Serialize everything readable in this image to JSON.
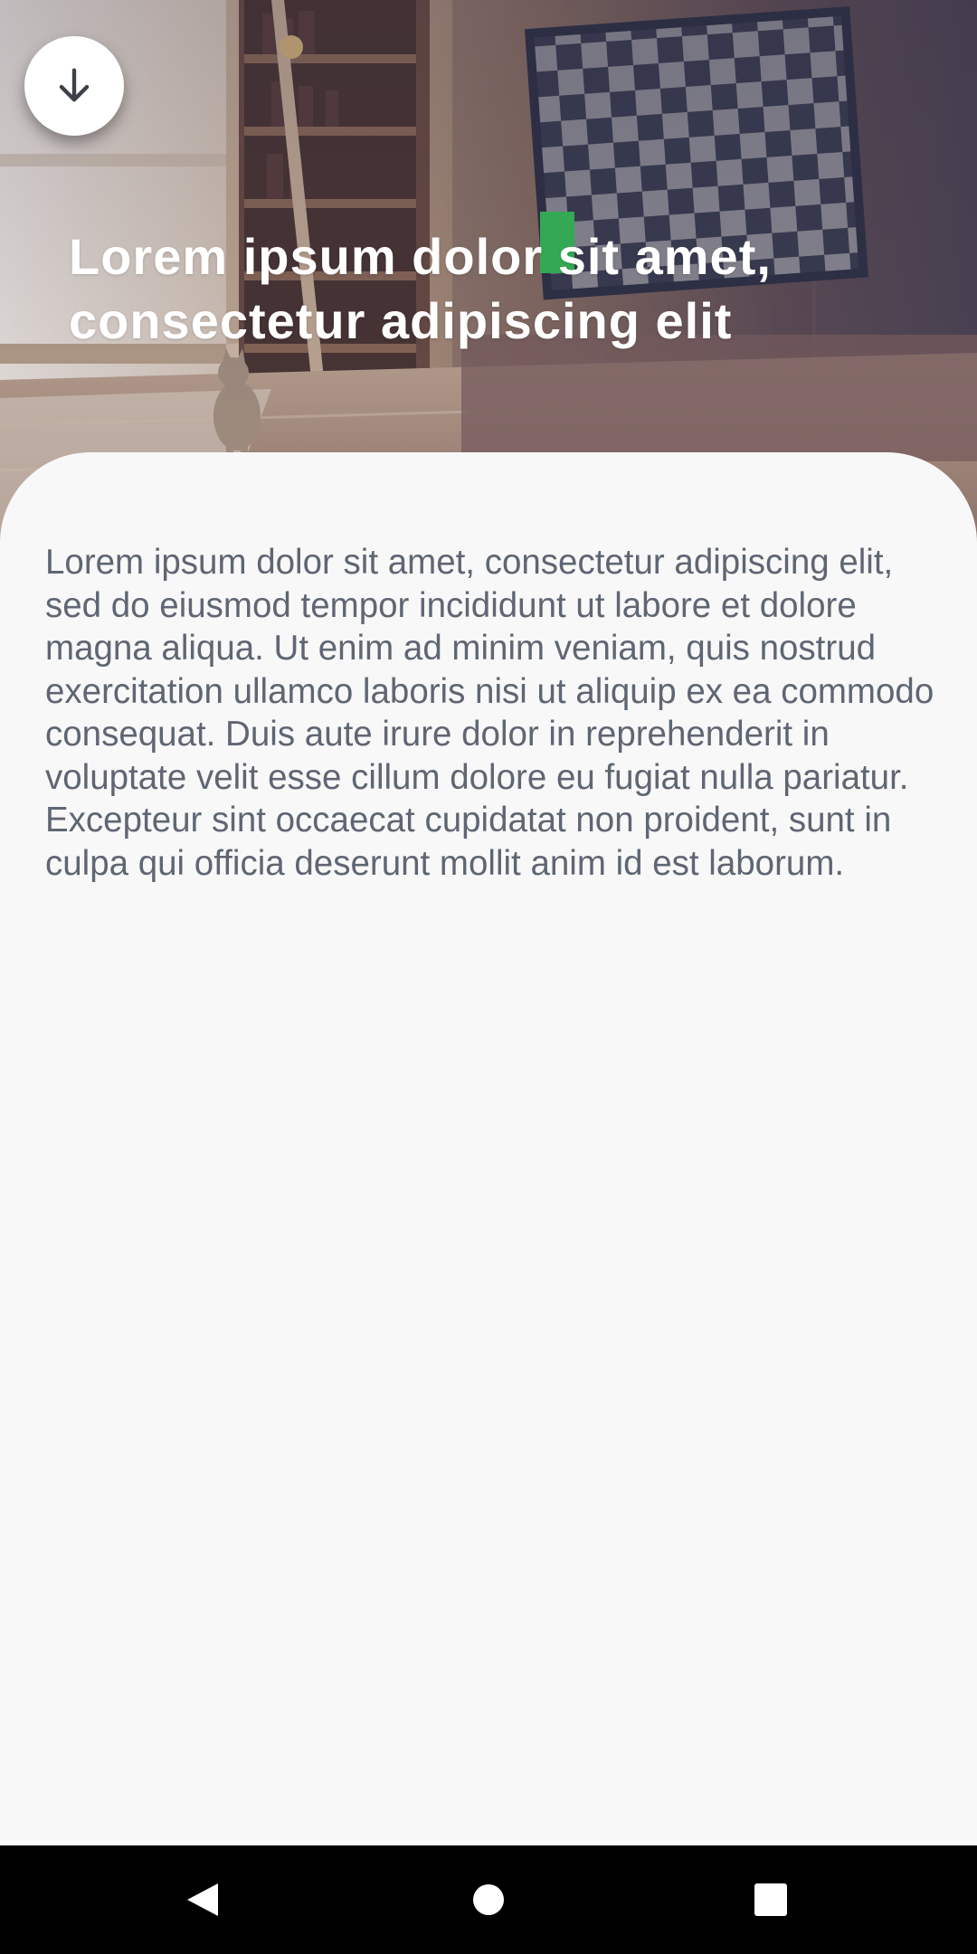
{
  "hero": {
    "title": "Lorem ipsum dolor sit amet, consectetur adipiscing elit",
    "back_button_icon": "arrow-down-icon"
  },
  "content": {
    "paragraph": "Lorem ipsum dolor sit amet, consectetur adipiscing elit, sed do eiusmod tempor incididunt ut labore et dolore magna aliqua. Ut enim ad minim veniam, quis nostrud exercitation ullamco laboris nisi ut aliquip ex ea commodo consequat. Duis aute irure dolor in reprehenderit in voluptate velit esse cillum dolore eu fugiat nulla pariatur. Excepteur sint occaecat cupidatat non proident, sunt in culpa qui officia deserunt mollit anim id est laborum."
  },
  "navbar": {
    "icons": [
      "back-triangle-icon",
      "home-circle-icon",
      "recents-square-icon"
    ]
  },
  "colors": {
    "sheet_background": "#f8f8f8",
    "body_text": "#5f6673",
    "title_text": "#ffffff",
    "green_marker": "#34a853",
    "navbar": "#000000"
  }
}
